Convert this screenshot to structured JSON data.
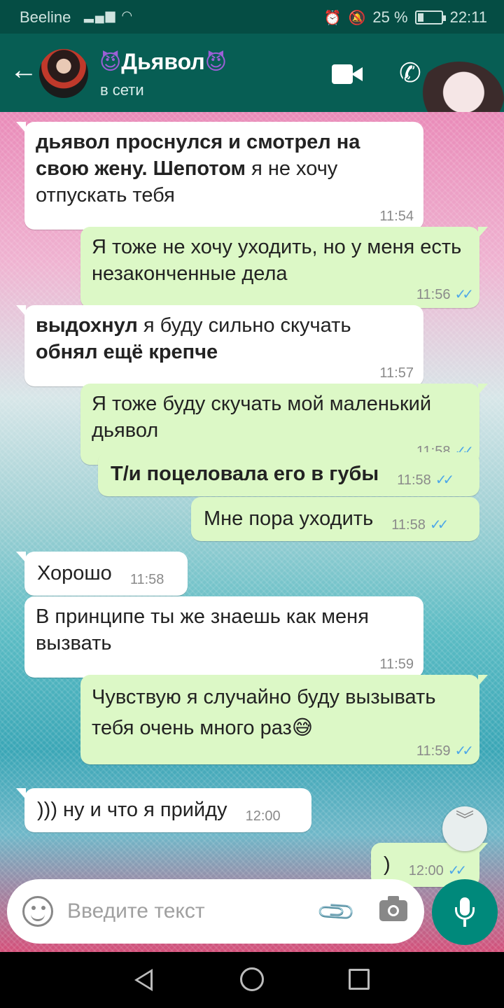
{
  "status_bar": {
    "carrier": "Beeline",
    "battery": "25 %",
    "battery_level": 0.25,
    "time": "22:11"
  },
  "header": {
    "back_icon": "arrow-left-icon",
    "contact_name": "Дьявол",
    "name_emoji": "😈",
    "status": "в сети",
    "video_icon": "video-call-icon",
    "call_icon": "phone-icon"
  },
  "messages": [
    {
      "dir": "in",
      "bold_a": "дьявол проснулся и смотрел на свою жену. Шепотом",
      "text_a": " я не хочу отпускать тебя",
      "time": "11:54"
    },
    {
      "dir": "out",
      "text": "Я тоже не хочу уходить, но у меня есть незаконченные дела",
      "time": "11:56",
      "ticks": "✓✓"
    },
    {
      "dir": "in",
      "bold_a": "выдохнул",
      "text_a": " я буду сильно скучать ",
      "bold_b": "обнял ещё крепче",
      "time": "11:57"
    },
    {
      "dir": "out",
      "text": "Я тоже буду скучать мой маленький дьявол",
      "time": "11:58",
      "ticks": "✓✓"
    },
    {
      "dir": "out",
      "bold_a": "Т/и поцеловала его в губы",
      "time": "11:58",
      "ticks": "✓✓"
    },
    {
      "dir": "out",
      "text": "Мне пора уходить",
      "time": "11:58",
      "ticks": "✓✓"
    },
    {
      "dir": "in",
      "text": "Хорошо",
      "time": "11:58"
    },
    {
      "dir": "in",
      "text": "В принципе ты же знаешь как меня вызвать",
      "time": "11:59"
    },
    {
      "dir": "out",
      "text": "Чувствую я случайно буду вызывать тебя очень много раз",
      "emoji": "😅",
      "time": "11:59",
      "ticks": "✓✓"
    },
    {
      "dir": "in",
      "text": "))) ну и что я прийду",
      "time": "12:00"
    },
    {
      "dir": "out",
      "text": ")",
      "time": "12:00",
      "ticks": "✓✓"
    }
  ],
  "composer": {
    "placeholder": "Введите текст",
    "emoji_icon": "emoji-icon",
    "attach_icon": "paperclip-icon",
    "camera_icon": "camera-icon",
    "mic_icon": "microphone-icon"
  },
  "scroll_down_icon": "double-chevron-down-icon",
  "colors": {
    "app_bar": "#075e54",
    "status_bar": "#054d44",
    "outgoing_bubble": "#dcf8c6",
    "incoming_bubble": "#ffffff",
    "read_ticks": "#4fa8e8",
    "mic_button": "#00897b"
  }
}
